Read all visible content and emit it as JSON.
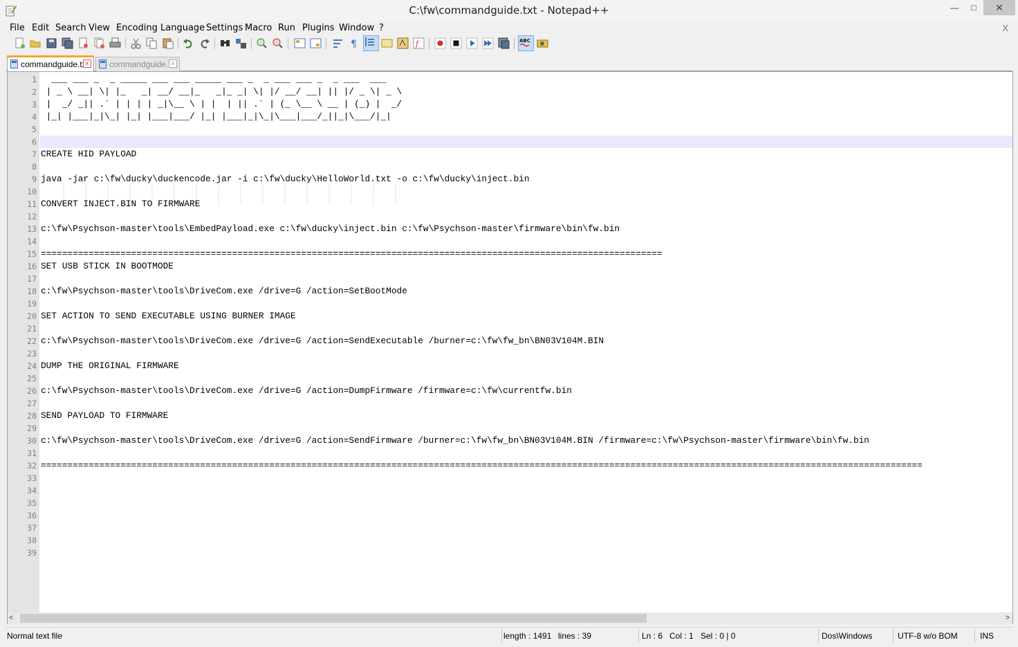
{
  "window": {
    "title": "C:\\fw\\commandguide.txt - Notepad++",
    "minimize": "—",
    "maximize": "□",
    "close": "✕"
  },
  "menu": {
    "items": [
      "File",
      "Edit",
      "Search",
      "View",
      "Encoding",
      "Language",
      "Settings",
      "Macro",
      "Run",
      "Plugins",
      "Window",
      "?"
    ],
    "close_doc": "X"
  },
  "toolbar": {
    "icons": [
      "new-file-icon",
      "open-file-icon",
      "save-icon",
      "save-all-icon",
      "close-icon",
      "close-all-icon",
      "print-icon",
      "cut-icon",
      "copy-icon",
      "paste-icon",
      "undo-icon",
      "redo-icon",
      "find-icon",
      "replace-icon",
      "zoom-in-icon",
      "zoom-out-icon",
      "sync-vertical-icon",
      "sync-horizontal-icon",
      "word-wrap-icon",
      "show-all-chars-icon",
      "indent-guide-icon",
      "user-language-icon",
      "doc-map-icon",
      "function-list-icon",
      "record-macro-icon",
      "stop-macro-icon",
      "play-macro-icon",
      "run-macro-multiple-icon",
      "save-macro-icon",
      "spell-check-icon",
      "spell-settings-icon"
    ]
  },
  "tabs": [
    {
      "label": "commandguide.txt",
      "active": true,
      "close": "x"
    },
    {
      "label": "commandguide.txt",
      "active": false,
      "close": "x"
    }
  ],
  "editor": {
    "line_numbers": [
      "1",
      "2",
      "3",
      "4",
      "5",
      "6",
      "7",
      "8",
      "9",
      "10",
      "11",
      "12",
      "13",
      "14",
      "15",
      "16",
      "17",
      "18",
      "19",
      "20",
      "21",
      "22",
      "23",
      "24",
      "25",
      "26",
      "27",
      "28",
      "29",
      "30",
      "31",
      "32",
      "33",
      "34",
      "35",
      "36",
      "37",
      "38",
      "39"
    ],
    "current_line": 6,
    "lines": [
      "  ___ ___ _  _ _____ ___ ___ _____ ___ _  _ ___ ___ _  _ ___  ___ ",
      " | _ \\ __| \\| |_   _| __/ __|_   _|_ _| \\| |/ __/ __| || |/ _ \\| _ \\",
      " |  _/ _|| .` | | | | _|\\__ \\ | |  | || .` | (_ \\__ \\ __ | (_) |  _/",
      " |_| |___|_|\\_| |_| |___|___/ |_| |___|_|\\_|\\___|___/_||_|\\___/|_|  ",
      "",
      "",
      "CREATE HID PAYLOAD",
      "",
      "java -jar c:\\fw\\ducky\\duckencode.jar -i c:\\fw\\ducky\\HelloWorld.txt -o c:\\fw\\ducky\\inject.bin",
      "",
      "CONVERT INJECT.BIN TO FIRMWARE",
      "",
      "c:\\fw\\Psychson-master\\tools\\EmbedPayload.exe c:\\fw\\ducky\\inject.bin c:\\fw\\Psychson-master\\firmware\\bin\\fw.bin",
      "",
      "=====================================================================================================================",
      "SET USB STICK IN BOOTMODE",
      "",
      "c:\\fw\\Psychson-master\\tools\\DriveCom.exe /drive=G /action=SetBootMode",
      "",
      "SET ACTION TO SEND EXECUTABLE USING BURNER IMAGE",
      "",
      "c:\\fw\\Psychson-master\\tools\\DriveCom.exe /drive=G /action=SendExecutable /burner=c:\\fw\\fw_bn\\BN03V104M.BIN",
      "",
      "DUMP THE ORIGINAL FIRMWARE",
      "",
      "c:\\fw\\Psychson-master\\tools\\DriveCom.exe /drive=G /action=DumpFirmware /firmware=c:\\fw\\currentfw.bin",
      "",
      "SEND PAYLOAD TO FIRMWARE",
      "",
      "c:\\fw\\Psychson-master\\tools\\DriveCom.exe /drive=G /action=SendFirmware /burner=c:\\fw\\fw_bn\\BN03V104M.BIN /firmware=c:\\fw\\Psychson-master\\firmware\\bin\\fw.bin",
      "",
      "======================================================================================================================================================================",
      "",
      "",
      "",
      "",
      "",
      "",
      ""
    ]
  },
  "scrollbar": {
    "left_arrow": "<",
    "right_arrow": ">"
  },
  "status": {
    "file_type": "Normal text file",
    "length": "length : 1491",
    "lines": "lines : 39",
    "ln": "Ln : 6",
    "col": "Col : 1",
    "sel": "Sel : 0 | 0",
    "eol": "Dos\\Windows",
    "encoding": "UTF-8 w/o BOM",
    "mode": "INS"
  },
  "colors": {
    "current_line": "#e8e8ff",
    "gutter": "#e4e4e4",
    "tab_accent": "#f5a623"
  }
}
